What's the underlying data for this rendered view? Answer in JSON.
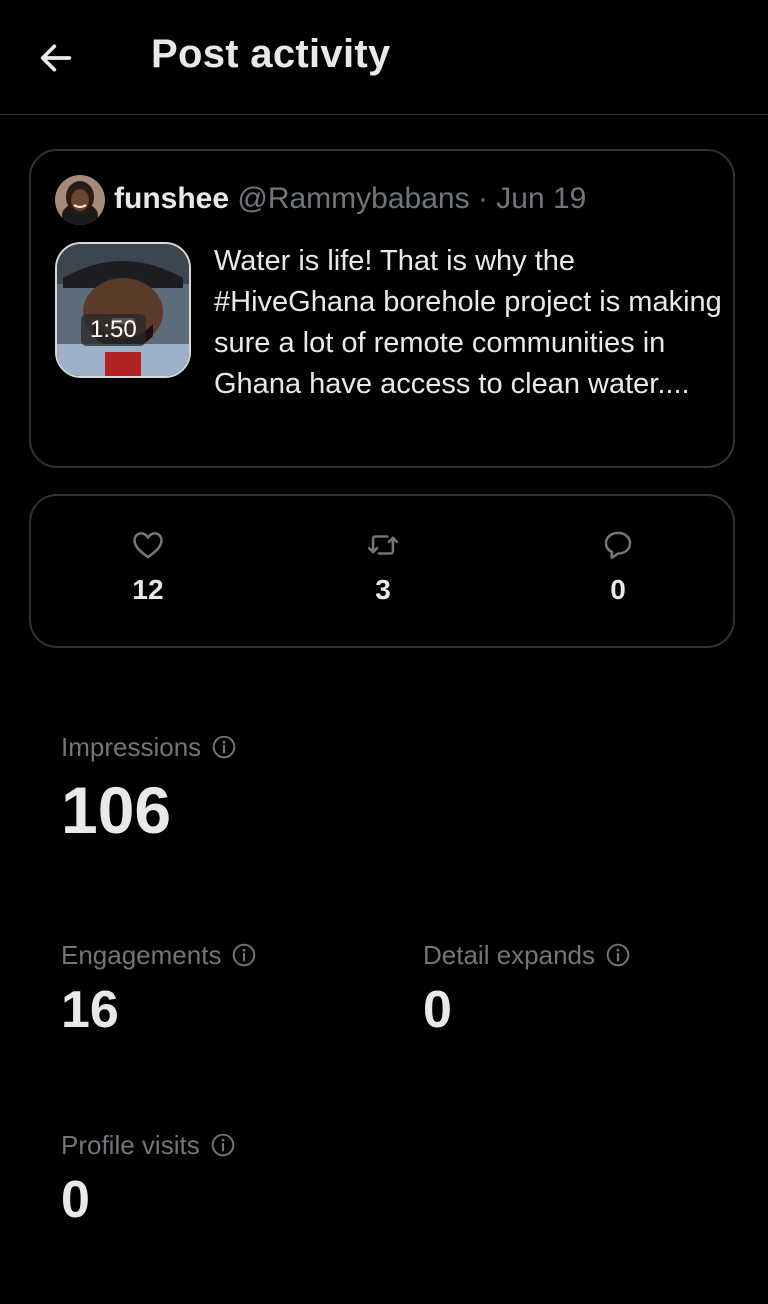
{
  "header": {
    "title": "Post activity",
    "back_icon": "arrow-left-icon"
  },
  "post": {
    "author_name": "funshee",
    "author_handle": "@Rammybabans",
    "separator": "·",
    "date": "Jun 19",
    "video_duration": "1:50",
    "text": "Water is life! That is why the #HiveGhana borehole project is making sure a lot of remote communities in Ghana have access to clean water...."
  },
  "engagement": {
    "likes": {
      "icon": "heart-icon",
      "count": "12"
    },
    "reposts": {
      "icon": "repost-icon",
      "count": "3"
    },
    "replies": {
      "icon": "reply-icon",
      "count": "0"
    }
  },
  "metrics": {
    "impressions": {
      "label": "Impressions",
      "value": "106"
    },
    "engagements": {
      "label": "Engagements",
      "value": "16"
    },
    "detail_expands": {
      "label": "Detail expands",
      "value": "0"
    },
    "profile_visits": {
      "label": "Profile visits",
      "value": "0"
    }
  },
  "colors": {
    "background": "#000000",
    "primary_text": "#e7e9ea",
    "secondary_text": "#71767b",
    "border": "#2f3336"
  }
}
